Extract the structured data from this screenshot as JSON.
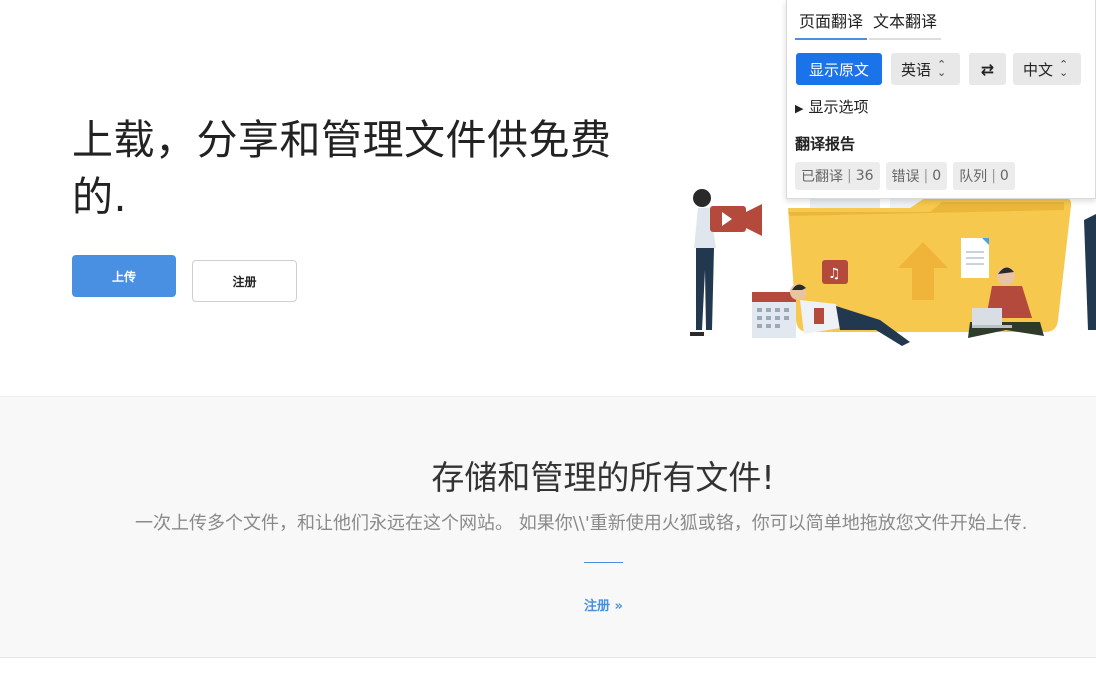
{
  "hero": {
    "title": "上载，分享和管理文件供免费的.",
    "upload_button": "上传",
    "register_button": "注册"
  },
  "features": {
    "title": "存储和管理的所有文件!",
    "description": "一次上传多个文件，和让他们永远在这个网站。 如果你\\\\'重新使用火狐或铬，你可以简单地拖放您文件开始上传.",
    "link": "注册 »"
  },
  "translate_panel": {
    "tabs": [
      "页面翻译",
      "文本翻译"
    ],
    "show_original": "显示原文",
    "source_lang": "英语",
    "target_lang": "中文",
    "swap_icon": "swap-icon",
    "show_options": "显示选项",
    "report_title": "翻译报告",
    "stats": {
      "translated_label": "已翻译",
      "translated_count": "36",
      "error_label": "错误",
      "error_count": "0",
      "queue_label": "队列",
      "queue_count": "0"
    }
  },
  "colors": {
    "accent": "#4a90e2",
    "translate_button": "#1a73e8",
    "folder": "#f7c84e",
    "features_bg": "#f8f8f8"
  }
}
